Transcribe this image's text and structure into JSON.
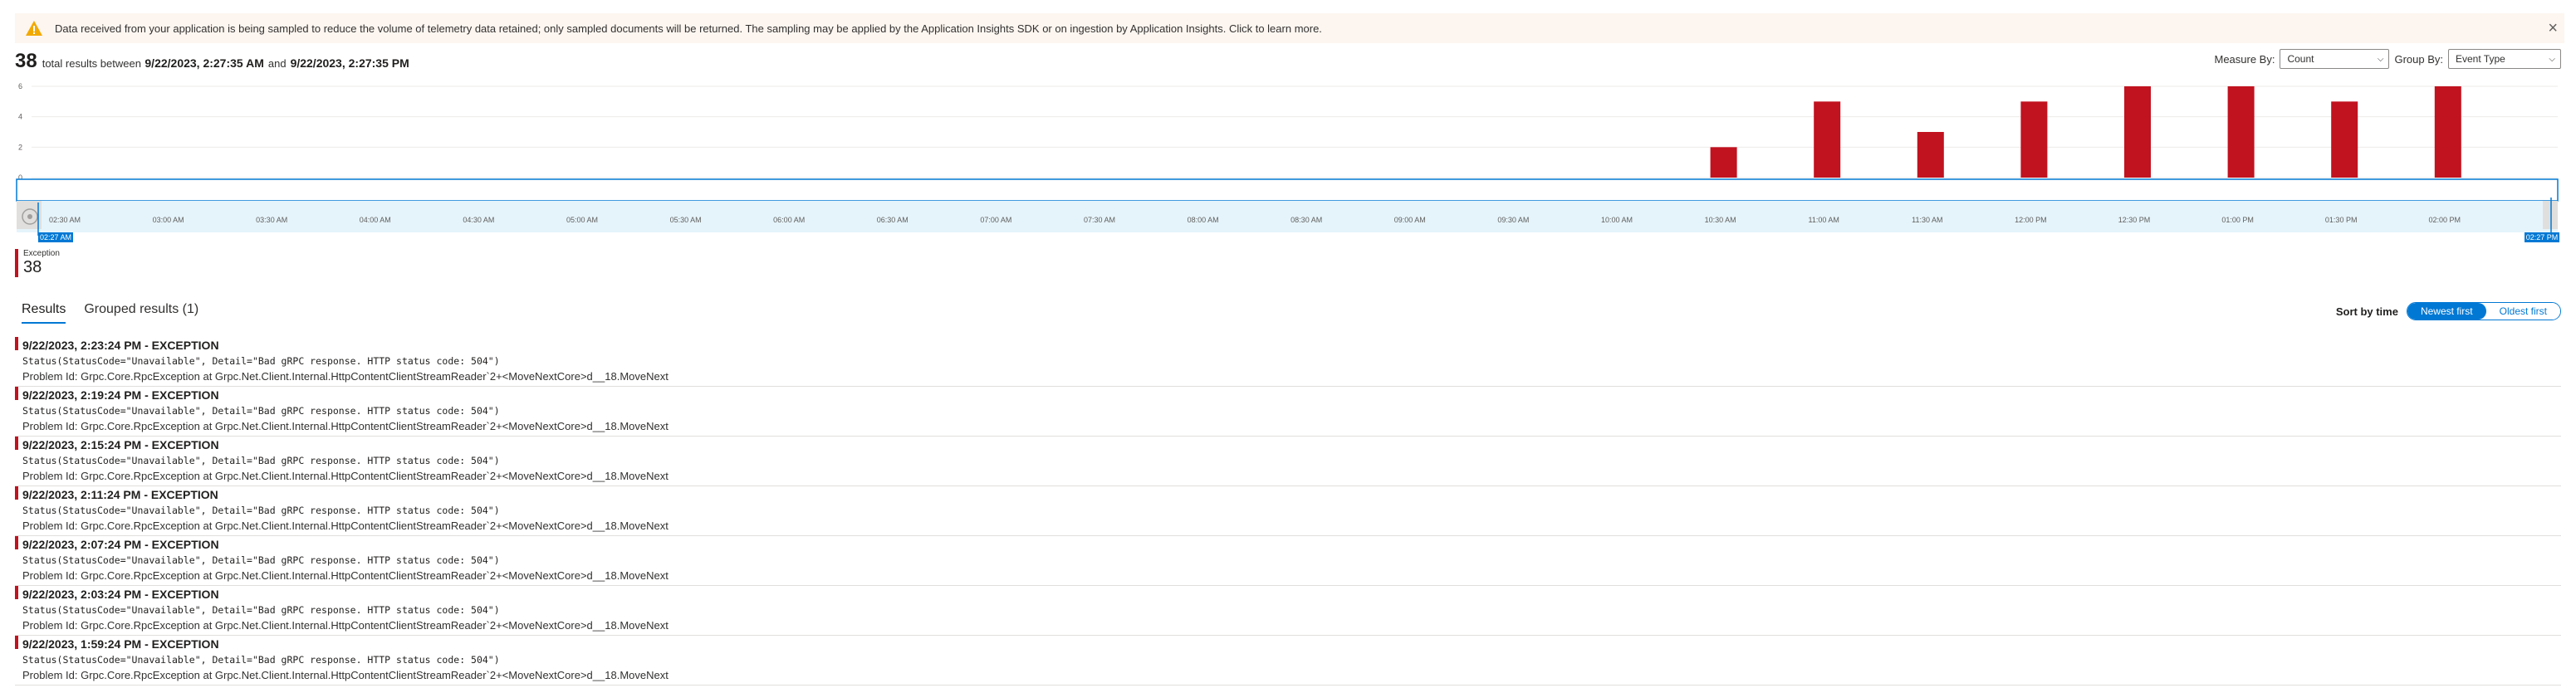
{
  "banner": {
    "icon": "warning-icon",
    "message": "Data received from your application is being sampled to reduce the volume of telemetry data retained; only sampled documents will be returned. The sampling may be applied by the Application Insights SDK or on ingestion by Application Insights. Click to learn more.",
    "close": "×"
  },
  "summary": {
    "count": "38",
    "text_before": "total results between",
    "start": "9/22/2023, 2:27:35 AM",
    "and": "and",
    "end": "9/22/2023, 2:27:35 PM"
  },
  "controls": {
    "measure_label": "Measure By:",
    "measure_value": "Count",
    "group_label": "Group By:",
    "group_value": "Event Type"
  },
  "chart_data": {
    "type": "bar",
    "y_ticks": [
      "0",
      "2",
      "4",
      "6"
    ],
    "ylim": [
      0,
      6
    ],
    "x_ticks": [
      "02:30 AM",
      "03:00 AM",
      "03:30 AM",
      "04:00 AM",
      "04:30 AM",
      "05:00 AM",
      "05:30 AM",
      "06:00 AM",
      "06:30 AM",
      "07:00 AM",
      "07:30 AM",
      "08:00 AM",
      "08:30 AM",
      "09:00 AM",
      "09:30 AM",
      "10:00 AM",
      "10:30 AM",
      "11:00 AM",
      "11:30 AM",
      "12:00 PM",
      "12:30 PM",
      "01:00 PM",
      "01:30 PM",
      "02:00 PM"
    ],
    "series": [
      {
        "color": "#c1121f",
        "points": [
          {
            "x": "10:30 AM",
            "y": 2
          },
          {
            "x": "11:00 AM",
            "y": 5
          },
          {
            "x": "11:30 AM",
            "y": 3
          },
          {
            "x": "12:00 PM",
            "y": 5
          },
          {
            "x": "12:30 PM",
            "y": 6
          },
          {
            "x": "01:00 PM",
            "y": 6
          },
          {
            "x": "01:30 PM",
            "y": 5
          },
          {
            "x": "02:00 PM",
            "y": 6
          }
        ]
      }
    ],
    "brush_start_label": "02:27 AM",
    "brush_end_label": "02:27 PM"
  },
  "legend": {
    "name": "Exception",
    "value": "38",
    "color": "#c1121f"
  },
  "tabs": [
    {
      "label": "Results",
      "active": true
    },
    {
      "label": "Grouped results (1)",
      "active": false
    }
  ],
  "sort": {
    "label": "Sort by time",
    "newest": "Newest first",
    "oldest": "Oldest first"
  },
  "results": [
    {
      "title": "9/22/2023, 2:23:24 PM - EXCEPTION",
      "detail": "Status(StatusCode=\"Unavailable\", Detail=\"Bad gRPC response. HTTP status code: 504\")",
      "problem": "Problem Id: Grpc.Core.RpcException at Grpc.Net.Client.Internal.HttpContentClientStreamReader`2+<MoveNextCore>d__18.MoveNext"
    },
    {
      "title": "9/22/2023, 2:19:24 PM - EXCEPTION",
      "detail": "Status(StatusCode=\"Unavailable\", Detail=\"Bad gRPC response. HTTP status code: 504\")",
      "problem": "Problem Id: Grpc.Core.RpcException at Grpc.Net.Client.Internal.HttpContentClientStreamReader`2+<MoveNextCore>d__18.MoveNext"
    },
    {
      "title": "9/22/2023, 2:15:24 PM - EXCEPTION",
      "detail": "Status(StatusCode=\"Unavailable\", Detail=\"Bad gRPC response. HTTP status code: 504\")",
      "problem": "Problem Id: Grpc.Core.RpcException at Grpc.Net.Client.Internal.HttpContentClientStreamReader`2+<MoveNextCore>d__18.MoveNext"
    },
    {
      "title": "9/22/2023, 2:11:24 PM - EXCEPTION",
      "detail": "Status(StatusCode=\"Unavailable\", Detail=\"Bad gRPC response. HTTP status code: 504\")",
      "problem": "Problem Id: Grpc.Core.RpcException at Grpc.Net.Client.Internal.HttpContentClientStreamReader`2+<MoveNextCore>d__18.MoveNext"
    },
    {
      "title": "9/22/2023, 2:07:24 PM - EXCEPTION",
      "detail": "Status(StatusCode=\"Unavailable\", Detail=\"Bad gRPC response. HTTP status code: 504\")",
      "problem": "Problem Id: Grpc.Core.RpcException at Grpc.Net.Client.Internal.HttpContentClientStreamReader`2+<MoveNextCore>d__18.MoveNext"
    },
    {
      "title": "9/22/2023, 2:03:24 PM - EXCEPTION",
      "detail": "Status(StatusCode=\"Unavailable\", Detail=\"Bad gRPC response. HTTP status code: 504\")",
      "problem": "Problem Id: Grpc.Core.RpcException at Grpc.Net.Client.Internal.HttpContentClientStreamReader`2+<MoveNextCore>d__18.MoveNext"
    },
    {
      "title": "9/22/2023, 1:59:24 PM - EXCEPTION",
      "detail": "Status(StatusCode=\"Unavailable\", Detail=\"Bad gRPC response. HTTP status code: 504\")",
      "problem": "Problem Id: Grpc.Core.RpcException at Grpc.Net.Client.Internal.HttpContentClientStreamReader`2+<MoveNextCore>d__18.MoveNext"
    }
  ]
}
